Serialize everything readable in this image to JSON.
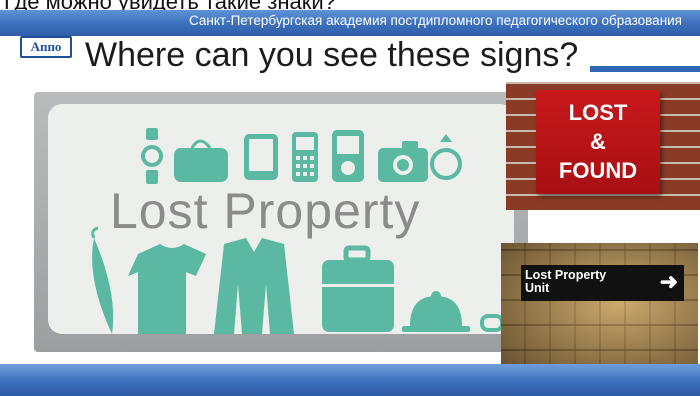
{
  "top_strip_text": "Где можно увидеть такие знаки?",
  "header": {
    "academy": "Санкт-Петербургская академия постдипломного педагогического образования",
    "logo": "Аппо"
  },
  "slide": {
    "title": "Where can you see these signs?"
  },
  "main_sign": {
    "text": "Lost Property",
    "icons_top": [
      "watch-icon",
      "purse-icon",
      "tablet-icon",
      "phone-icon",
      "music-player-icon",
      "camera-icon",
      "ring-icon"
    ],
    "icons_bottom": [
      "umbrella-icon",
      "tshirt-icon",
      "jacket-icon",
      "suitcase-icon",
      "hat-icon",
      "glasses-icon"
    ],
    "icon_color": "#5ab9a0"
  },
  "lost_found_sign": {
    "line1": "LOST",
    "line2": "&",
    "line3": "FOUND"
  },
  "unit_sign": {
    "line1": "Lost Property",
    "line2": "Unit",
    "arrow": "➜"
  }
}
